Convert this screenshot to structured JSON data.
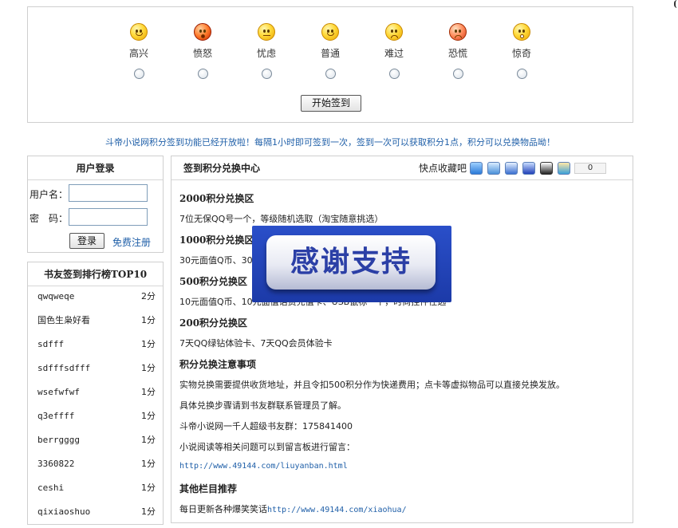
{
  "moods": [
    {
      "label": "高兴",
      "icon": "happy-face-icon"
    },
    {
      "label": "愤怒",
      "icon": "angry-face-icon"
    },
    {
      "label": "忧虑",
      "icon": "worried-face-icon"
    },
    {
      "label": "普通",
      "icon": "neutral-face-icon"
    },
    {
      "label": "难过",
      "icon": "sad-face-icon"
    },
    {
      "label": "恐慌",
      "icon": "panic-face-icon"
    },
    {
      "label": "惊奇",
      "icon": "surprised-face-icon"
    }
  ],
  "start_button": "开始签到",
  "notice": "斗帝小说网积分签到功能已经开放啦！每隔1小时即可签到一次，签到一次可以获取积分1点，积分可以兑换物品呦！",
  "login": {
    "title": "用户登录",
    "username_label": "用户名：",
    "password_label": "密　码：",
    "username_value": "",
    "password_value": "",
    "login_button": "登录",
    "register_link": "免费注册"
  },
  "ranking": {
    "title": "书友签到排行榜TOP10",
    "rows": [
      {
        "name": "qwqweqe",
        "score": "2分"
      },
      {
        "name": "国色生枭好看",
        "score": "1分"
      },
      {
        "name": "sdfff",
        "score": "1分"
      },
      {
        "name": "sdfffsdfff",
        "score": "1分"
      },
      {
        "name": "wsefwfwf",
        "score": "1分"
      },
      {
        "name": "q3effff",
        "score": "1分"
      },
      {
        "name": "berrgggg",
        "score": "1分"
      },
      {
        "name": "3360822",
        "score": "1分"
      },
      {
        "name": "ceshi",
        "score": "1分"
      },
      {
        "name": "qixiaoshuo",
        "score": "1分"
      }
    ]
  },
  "exchange": {
    "title": "签到积分兑换中心",
    "fav_label": "快点收藏吧",
    "fav_count": "0",
    "fav_icons": [
      "star-bookmark-icon",
      "p-share-icon",
      "tieba-icon",
      "baidu-paw-icon",
      "qq-penguin-icon",
      "kaixin-icon"
    ],
    "sections": [
      {
        "text": "2000积分兑换区",
        "heading": true
      },
      {
        "text": "7位无保QQ号一个，等级随机选取（淘宝随意挑选）"
      },
      {
        "text": "1000积分兑换区",
        "heading": true
      },
      {
        "text": "30元面值Q币、30元面值话费充值卡、时尚主流电脑键盘一个"
      },
      {
        "text": "500积分兑换区",
        "heading": true
      },
      {
        "text": "10元面值Q币、10元面值话费充值卡、USB鼠标一个，时尚挂件任选"
      },
      {
        "text": "200积分兑换区",
        "heading": true
      },
      {
        "text": "7天QQ绿钻体验卡、7天QQ会员体验卡"
      },
      {
        "text": "积分兑换注意事项",
        "heading": true
      },
      {
        "text": "实物兑换需要提供收货地址，并且令扣500积分作为快递费用；点卡等虚拟物品可以直接兑换发放。"
      },
      {
        "text": "具体兑换步骤请到书友群联系管理员了解。"
      },
      {
        "text": "斗帝小说网一千人超级书友群：175841400"
      },
      {
        "text": "小说阅读等相关问题可以到留言板进行留言："
      },
      {
        "text": "http://www.49144.com/liuyanban.html",
        "link": true
      },
      {
        "text": "其他栏目推荐",
        "heading": true
      },
      {
        "text": "每日更新各种爆笑笑话",
        "suffix_link": "http://www.49144.com/xiaohua/"
      }
    ]
  },
  "overlay_text": "感谢支持"
}
